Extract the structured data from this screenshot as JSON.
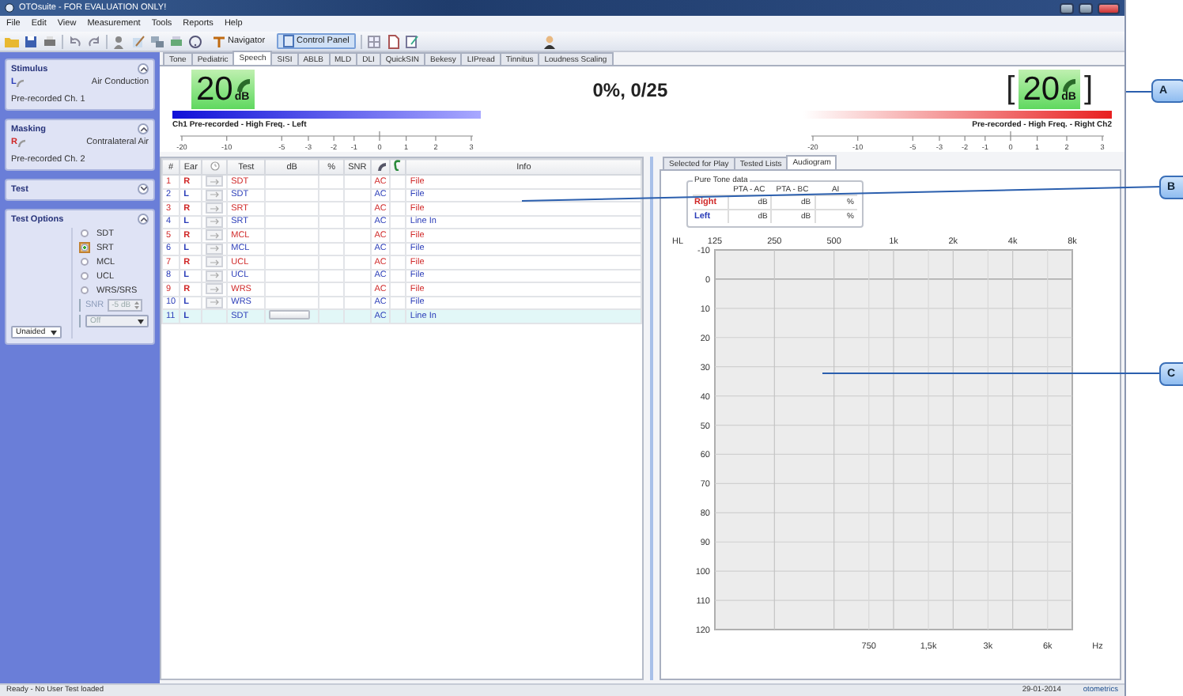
{
  "window": {
    "title": "OTOsuite - FOR EVALUATION ONLY!"
  },
  "menu": [
    "File",
    "Edit",
    "View",
    "Measurement",
    "Tools",
    "Reports",
    "Help"
  ],
  "toolbar": {
    "navigator": "Navigator",
    "control_panel": {
      "label": "Control Panel",
      "selected": true
    }
  },
  "left_panel": {
    "stimulus": {
      "title": "Stimulus",
      "expanded": true,
      "ear": "L",
      "color": "#2a3cb8",
      "transducer": "Air Conduction",
      "source": "Pre-recorded Ch. 1"
    },
    "masking": {
      "title": "Masking",
      "expanded": true,
      "ear": "R",
      "color": "#d02828",
      "transducer": "Contralateral Air",
      "source": "Pre-recorded Ch. 2"
    },
    "test": {
      "title": "Test",
      "expanded": false
    },
    "test_options": {
      "title": "Test Options",
      "expanded": true,
      "options": [
        {
          "label": "SDT",
          "selected": false
        },
        {
          "label": "SRT",
          "selected": true
        },
        {
          "label": "MCL",
          "selected": false
        },
        {
          "label": "UCL",
          "selected": false
        },
        {
          "label": "WRS/SRS",
          "selected": false
        }
      ],
      "snr": {
        "label": "SNR",
        "value": "-5 dB",
        "disabled": true
      },
      "snr_mode": {
        "value": "Off",
        "disabled": true
      },
      "aid": {
        "value": "Unaided"
      }
    }
  },
  "test_tabs": [
    {
      "label": "Tone",
      "selected": false
    },
    {
      "label": "Pediatric",
      "selected": false
    },
    {
      "label": "Speech",
      "selected": true
    },
    {
      "label": "SISI",
      "selected": false
    },
    {
      "label": "ABLB",
      "selected": false
    },
    {
      "label": "MLD",
      "selected": false
    },
    {
      "label": "DLI",
      "selected": false
    },
    {
      "label": "QuickSIN",
      "selected": false
    },
    {
      "label": "Bekesy",
      "selected": false
    },
    {
      "label": "LIPread",
      "selected": false
    },
    {
      "label": "Tinnitus",
      "selected": false
    },
    {
      "label": "Loudness Scaling",
      "selected": false
    }
  ],
  "meter": {
    "left": {
      "value": "20",
      "unit": "dB",
      "label": "Ch1  Pre-recorded - High Freq. - Left",
      "scale": [
        "-20",
        "-10",
        "-5",
        "-3",
        "-2",
        "-1",
        "0",
        "1",
        "2",
        "3"
      ]
    },
    "score": "0%, 0/25",
    "right": {
      "value": "20",
      "unit": "dB",
      "bracket_open": "[",
      "bracket_close": "]",
      "label": "Pre-recorded - High Freq. - Right  Ch2",
      "scale": [
        "-20",
        "-10",
        "-5",
        "-3",
        "-2",
        "-1",
        "0",
        "1",
        "2",
        "3"
      ]
    }
  },
  "table": {
    "columns": [
      {
        "kind": "text",
        "label": "#"
      },
      {
        "kind": "text",
        "label": "Ear"
      },
      {
        "kind": "clock"
      },
      {
        "kind": "text",
        "label": "Test"
      },
      {
        "kind": "text",
        "label": "dB"
      },
      {
        "kind": "text",
        "label": "%"
      },
      {
        "kind": "text",
        "label": "SNR"
      },
      {
        "kind": "headphone"
      },
      {
        "kind": "ear"
      },
      {
        "kind": "text",
        "label": "Info"
      }
    ],
    "rows": [
      {
        "num": "1",
        "ear": "R",
        "color": "#d02828",
        "kind": "arrow",
        "test": "SDT",
        "transducer": "AC",
        "info": "File",
        "selected": false
      },
      {
        "num": "2",
        "ear": "L",
        "color": "#2a3cb8",
        "kind": "arrow",
        "test": "SDT",
        "transducer": "AC",
        "info": "File",
        "selected": false
      },
      {
        "num": "3",
        "ear": "R",
        "color": "#d02828",
        "kind": "arrow",
        "test": "SRT",
        "transducer": "AC",
        "info": "File",
        "selected": false
      },
      {
        "num": "4",
        "ear": "L",
        "color": "#2a3cb8",
        "kind": "arrow",
        "test": "SRT",
        "transducer": "AC",
        "info": "Line In",
        "selected": false
      },
      {
        "num": "5",
        "ear": "R",
        "color": "#d02828",
        "kind": "arrow",
        "test": "MCL",
        "transducer": "AC",
        "info": "File",
        "selected": false
      },
      {
        "num": "6",
        "ear": "L",
        "color": "#2a3cb8",
        "kind": "arrow",
        "test": "MCL",
        "transducer": "AC",
        "info": "File",
        "selected": false
      },
      {
        "num": "7",
        "ear": "R",
        "color": "#d02828",
        "kind": "arrow",
        "test": "UCL",
        "transducer": "AC",
        "info": "File",
        "selected": false
      },
      {
        "num": "8",
        "ear": "L",
        "color": "#2a3cb8",
        "kind": "arrow",
        "test": "UCL",
        "transducer": "AC",
        "info": "File",
        "selected": false
      },
      {
        "num": "9",
        "ear": "R",
        "color": "#d02828",
        "kind": "arrow",
        "test": "WRS",
        "transducer": "AC",
        "info": "File",
        "selected": false
      },
      {
        "num": "10",
        "ear": "L",
        "color": "#2a3cb8",
        "kind": "arrow",
        "test": "WRS",
        "transducer": "AC",
        "info": "File",
        "selected": false
      },
      {
        "num": "11",
        "ear": "L",
        "color": "#2a3cb8",
        "kind": "input",
        "test": "SDT",
        "transducer": "AC",
        "info": "Line In",
        "selected": true
      }
    ]
  },
  "right_panel": {
    "tabs": [
      {
        "label": "Selected for Play",
        "selected": false
      },
      {
        "label": "Tested Lists",
        "selected": false
      },
      {
        "label": "Audiogram",
        "selected": true
      }
    ],
    "pure_tone": {
      "title": "Pure Tone data",
      "columns": [
        "PTA - AC",
        "PTA - BC",
        "AI"
      ],
      "rows": [
        {
          "label": "Right",
          "color": "#d02828",
          "cells": [
            "dB",
            "dB",
            "%"
          ]
        },
        {
          "label": "Left",
          "color": "#2a3cb8",
          "cells": [
            "dB",
            "dB",
            "%"
          ]
        }
      ]
    },
    "audiogram": {
      "y_unit": "HL",
      "x_unit": "Hz",
      "top_labels": [
        "125",
        "250",
        "500",
        "1k",
        "2k",
        "4k",
        "8k"
      ],
      "bottom_labels": [
        "750",
        "1,5k",
        "3k",
        "6k"
      ],
      "y_labels": [
        "-10",
        "0",
        "10",
        "20",
        "30",
        "40",
        "50",
        "60",
        "70",
        "80",
        "90",
        "100",
        "110",
        "120"
      ]
    }
  },
  "status_bar": {
    "message": "Ready - No User Test loaded",
    "date": "29-01-2014",
    "brand": "otometrics"
  },
  "callouts": [
    "A",
    "B",
    "C"
  ]
}
